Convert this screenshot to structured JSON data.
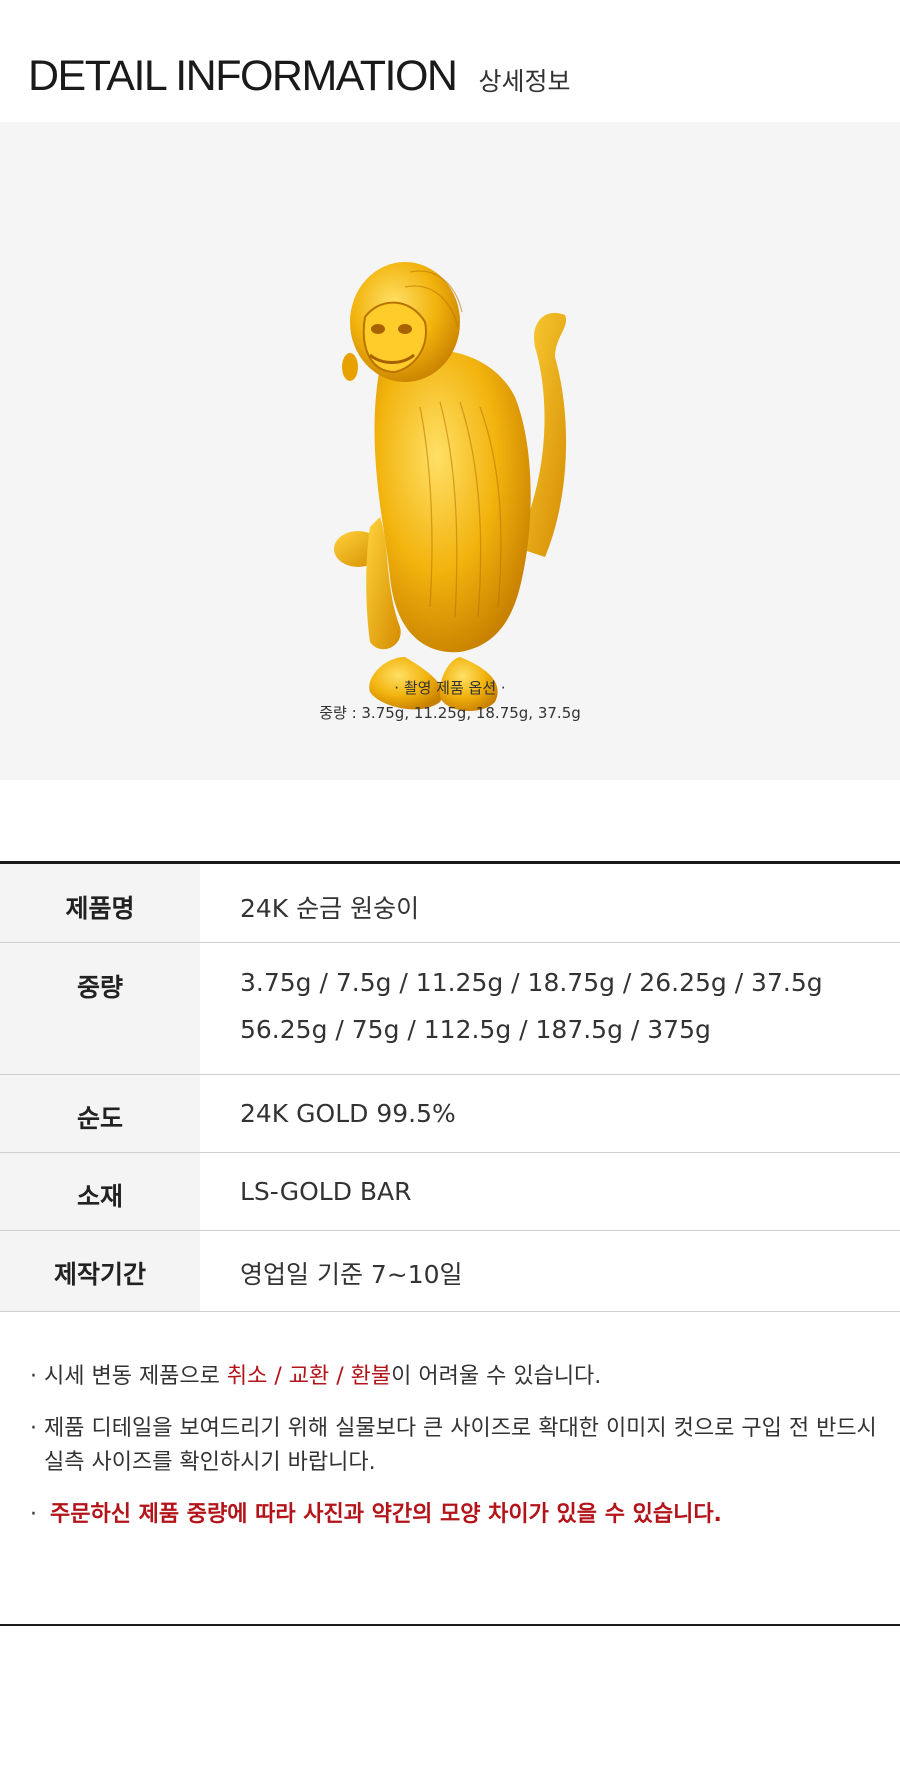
{
  "header": {
    "title": "DETAIL INFORMATION",
    "subtitle": "상세정보"
  },
  "photo": {
    "caption_title": "· 촬영 제품 옵션 ·",
    "caption_weights": "중량 : 3.75g, 11.25g, 18.75g, 37.5g",
    "colors": {
      "gold_light": "#ffe066",
      "gold": "#f2b30d",
      "gold_dark": "#c77f00"
    }
  },
  "spec": {
    "rows": [
      {
        "key": "제품명",
        "values": [
          "24K 순금 원숭이"
        ]
      },
      {
        "key": "중량",
        "values": [
          "3.75g / 7.5g / 11.25g / 18.75g / 26.25g / 37.5g",
          "56.25g / 75g / 112.5g / 187.5g / 375g"
        ]
      },
      {
        "key": "순도",
        "values": [
          "24K GOLD 99.5%"
        ]
      },
      {
        "key": "소재",
        "values": [
          "LS-GOLD BAR"
        ]
      },
      {
        "key": "제작기간",
        "values": [
          "영업일 기준 7~10일"
        ]
      }
    ]
  },
  "notes": {
    "bullet": "·",
    "n1_before": "시세 변동 제품으로 ",
    "n1_red": "취소 / 교환 /  환불",
    "n1_after": "이 어려울 수 있습니다.",
    "n2_line1": "제품 디테일을 보여드리기 위해 실물보다 큰 사이즈로 확대한 이미지 컷으로 구입 전 반드시",
    "n2_line2": "실측 사이즈를 확인하시기 바랍니다.",
    "n3_bullet": "·",
    "n3": "주문하신 제품 중량에 따라 사진과 약간의 모양 차이가 있을 수 있습니다."
  }
}
